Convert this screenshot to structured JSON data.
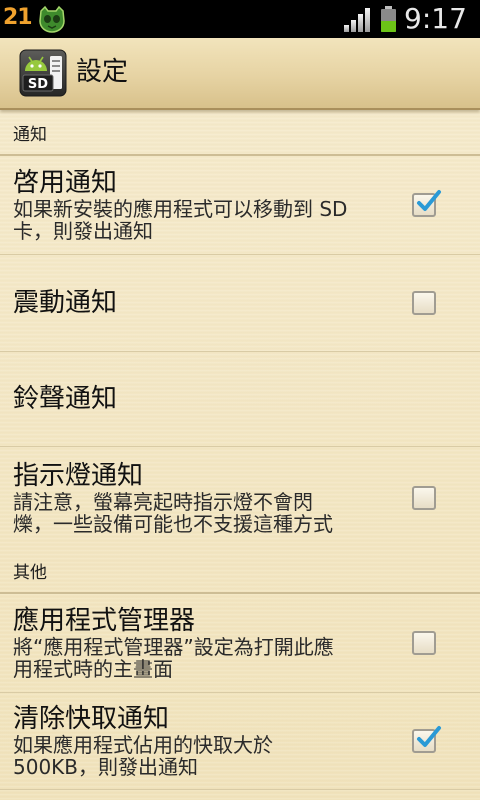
{
  "status_bar": {
    "left_number": "21",
    "notification_icon": "app-notification-icon",
    "signal_bars": 4,
    "signal_bars_max": 4,
    "battery_level": 0.5,
    "time": "9:17"
  },
  "title_bar": {
    "app_icon": "sd-card-app-icon",
    "app_icon_text": "SD",
    "title": "設定"
  },
  "sections": [
    {
      "header": "通知",
      "items": [
        {
          "title": "啓用通知",
          "summary_lines": [
            "如果新安裝的應用程式可以移動到 SD",
            "卡，則發出通知"
          ],
          "has_checkbox": true,
          "checked": true
        },
        {
          "title": "震動通知",
          "has_checkbox": true,
          "checked": false
        },
        {
          "title": "鈴聲通知",
          "has_checkbox": false
        },
        {
          "title": "指示燈通知",
          "summary_lines": [
            "請注意，螢幕亮起時指示燈不會閃",
            "爍，一些設備可能也不支援這種方式"
          ],
          "has_checkbox": true,
          "checked": false
        }
      ]
    },
    {
      "header": "其他",
      "items": [
        {
          "title": "應用程式管理器",
          "summary_lines": [
            "將“應用程式管理器”設定為打開此應",
            "用程式時的主畫面"
          ],
          "has_checkbox": true,
          "checked": false
        },
        {
          "title": "清除快取通知",
          "summary_lines": [
            "如果應用程式佔用的快取大於",
            "500KB，則發出通知"
          ],
          "has_checkbox": true,
          "checked": true
        }
      ]
    }
  ],
  "colors": {
    "status_bar_bg": "#000000",
    "left_number": "#f0a22e",
    "accent_check": "#2a9ad6",
    "battery_fill": "#6cc417",
    "list_background": "#f3e6c2",
    "title_bar": "#e2ce9c"
  }
}
